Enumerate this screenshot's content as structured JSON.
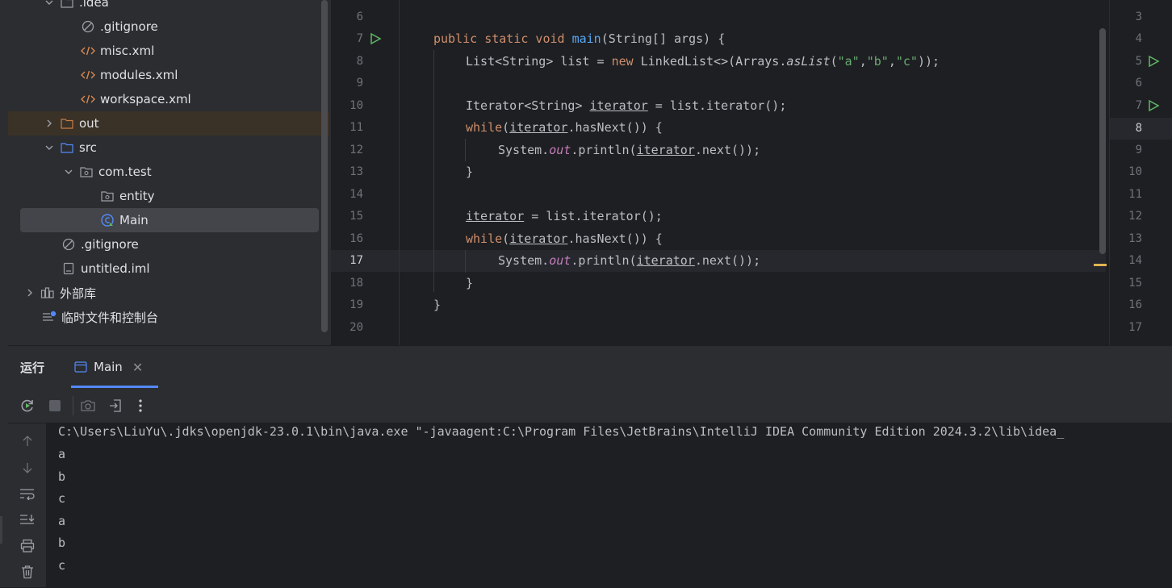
{
  "project_tree": {
    "rows": [
      {
        "label": ".idea",
        "icon": "folder-icon"
      },
      {
        "label": ".gitignore",
        "icon": "ignored-file-icon"
      },
      {
        "label": "misc.xml",
        "icon": "xml-file-icon"
      },
      {
        "label": "modules.xml",
        "icon": "xml-file-icon"
      },
      {
        "label": "workspace.xml",
        "icon": "xml-file-icon"
      },
      {
        "label": "out",
        "icon": "folder-icon"
      },
      {
        "label": "src",
        "icon": "source-folder-icon"
      },
      {
        "label": "com.test",
        "icon": "package-icon"
      },
      {
        "label": "entity",
        "icon": "package-icon"
      },
      {
        "label": "Main",
        "icon": "java-class-icon"
      },
      {
        "label": ".gitignore",
        "icon": "ignored-file-icon"
      },
      {
        "label": "untitled.iml",
        "icon": "iml-file-icon"
      },
      {
        "label": "外部库",
        "icon": "library-icon"
      },
      {
        "label": "临时文件和控制台",
        "icon": "scratches-icon"
      }
    ]
  },
  "editor": {
    "line_numbers": [
      "6",
      "7",
      "8",
      "9",
      "10",
      "11",
      "12",
      "13",
      "14",
      "15",
      "16",
      "17",
      "18",
      "19",
      "20"
    ],
    "current_line": "17",
    "code": {
      "l7_kw": "public static void ",
      "l7_fn": "main",
      "l7_rest": "(String[] args) {",
      "l8_a": "List<String> list = ",
      "l8_kw": "new",
      "l8_b": " LinkedList<>(Arrays.",
      "l8_st": "asList",
      "l8_c": "(",
      "l8_s1": "\"a\"",
      "l8_comma1": ",",
      "l8_s2": "\"b\"",
      "l8_comma2": ",",
      "l8_s3": "\"c\"",
      "l8_end": "));",
      "l10_a": "Iterator<String> ",
      "l10_var": "iterator",
      "l10_b": " = list.iterator();",
      "while_kw": "while",
      "while_open": "(",
      "iter_var": "iterator",
      "while_rest": ".hasNext()) {",
      "sys": "System.",
      "out": "out",
      "println_open": ".println(",
      "next_close": ".next());",
      "close_brace": "}",
      "l15_rest": " = list.iterator();"
    }
  },
  "right_gutter": {
    "line_numbers": [
      "3",
      "4",
      "5",
      "6",
      "7",
      "8",
      "9",
      "10",
      "11",
      "12",
      "13",
      "14",
      "15",
      "16",
      "17"
    ],
    "current_line": "8"
  },
  "run_panel": {
    "title": "运行",
    "tab_label": "Main",
    "tab_close": "✕",
    "console_lines": [
      "C:\\Users\\LiuYu\\.jdks\\openjdk-23.0.1\\bin\\java.exe \"-javaagent:C:\\Program Files\\JetBrains\\IntelliJ IDEA Community Edition 2024.3.2\\lib\\idea_",
      "a",
      "b",
      "c",
      "a",
      "b",
      "c"
    ]
  },
  "colors": {
    "accent": "#548af7",
    "run_green": "#5fb865",
    "folder_orange": "#c77d48",
    "source_blue": "#548af7"
  }
}
